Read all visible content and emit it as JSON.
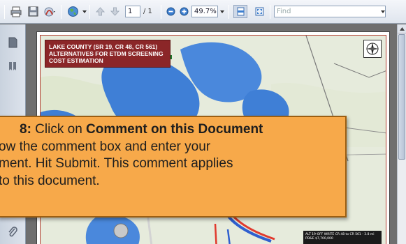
{
  "toolbar": {
    "page_current": "1",
    "page_total": "/ 1",
    "zoom": "49.7%",
    "find_placeholder": "Find"
  },
  "map": {
    "title_lines": [
      "LAKE COUNTY (SR 19, CR 48, CR 561)",
      "ALTERNATIVES FOR ETDM SCREENING",
      "COST ESTIMATION"
    ],
    "legend_lines": [
      "ALT 19-OFF WRITE CR 48 to CR 561 - 3.8 mi",
      "PD&E          $7,700,000"
    ]
  },
  "callout": {
    "step_label": "8:",
    "line1_text": " Click on ",
    "line1_bold": "Comment on this Document",
    "line2": "ow the comment box and enter your",
    "line3": "ment.  Hit Submit.  This comment applies",
    "line4": " to this document."
  },
  "colors": {
    "callout_bg": "#f7a94a",
    "map_title_bg": "#8b2628",
    "water": "#3f7fd6"
  }
}
